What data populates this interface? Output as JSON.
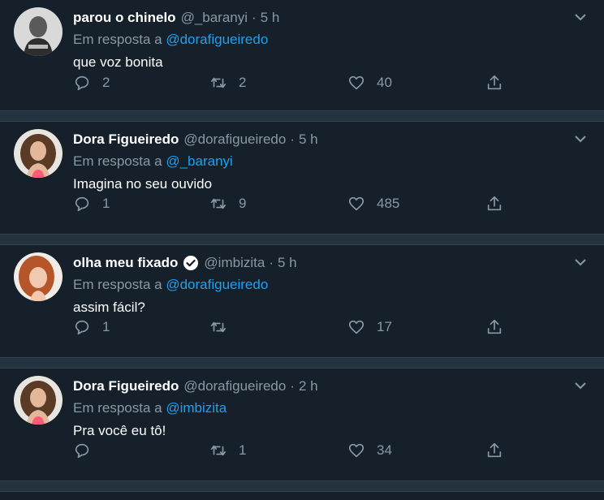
{
  "colors": {
    "background": "#15202b",
    "divider": "#253341",
    "muted": "#8899a6",
    "accent": "#1da1f2"
  },
  "tweets": [
    {
      "name": "parou o chinelo",
      "handle": "@_baranyi",
      "dot": "·",
      "time": "5 h",
      "reply_prefix": "Em resposta a",
      "reply_to": "@dorafigueiredo",
      "text": "que voz bonita",
      "replies": "2",
      "retweets": "2",
      "likes": "40",
      "verified": false,
      "avatar": "avatar-bw-icon"
    },
    {
      "name": "Dora Figueiredo",
      "handle": "@dorafigueiredo",
      "dot": "·",
      "time": "5 h",
      "reply_prefix": "Em resposta a",
      "reply_to": "@_baranyi",
      "text": "Imagina no seu ouvido",
      "replies": "1",
      "retweets": "9",
      "likes": "485",
      "verified": false,
      "avatar": "avatar-curly-hair-icon"
    },
    {
      "name": "olha meu fixado",
      "handle": "@imbizita",
      "dot": "·",
      "time": "5 h",
      "reply_prefix": "Em resposta a",
      "reply_to": "@dorafigueiredo",
      "text": "assim fácil?",
      "replies": "1",
      "retweets": "",
      "likes": "17",
      "verified": true,
      "avatar": "avatar-red-hair-icon"
    },
    {
      "name": "Dora Figueiredo",
      "handle": "@dorafigueiredo",
      "dot": "·",
      "time": "2 h",
      "reply_prefix": "Em resposta a",
      "reply_to": "@imbizita",
      "text": "Pra você eu tô!",
      "replies": "",
      "retweets": "1",
      "likes": "34",
      "verified": false,
      "avatar": "avatar-curly-hair-icon"
    }
  ]
}
